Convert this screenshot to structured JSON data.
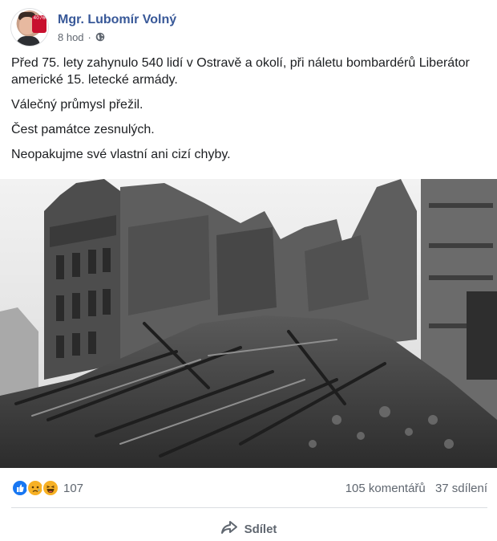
{
  "post": {
    "author": "Mgr. Lubomír Volný",
    "time": "8 hod",
    "separator": "·",
    "paragraphs": [
      "Před 75. lety zahynulo 540 lidí v Ostravě a okolí, při náletu bombardérů Liberátor americké 15. letecké armády.",
      "Válečný průmysl přežil.",
      "Čest památce zesnulých.",
      "Neopakujme své vlastní ani cizí chyby."
    ],
    "avatar_badge": "4076"
  },
  "stats": {
    "reactions_count": "107",
    "comments": "105 komentářů",
    "shares": "37 sdílení"
  },
  "actions": {
    "share_label": "Sdílet"
  },
  "colors": {
    "author_link": "#385898",
    "secondary_text": "#606770",
    "like_blue": "#1877f2",
    "emoji_yellow": "#f7b125"
  },
  "icons": {
    "privacy": "globe-icon",
    "share": "share-arrow-icon",
    "reactions": [
      "like-icon",
      "sad-icon",
      "haha-icon"
    ]
  }
}
